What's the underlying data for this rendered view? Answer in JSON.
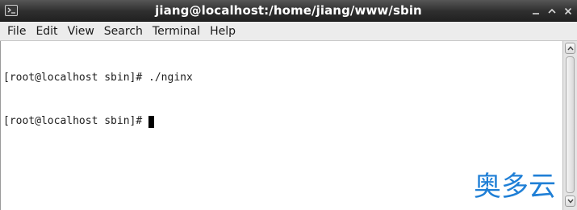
{
  "window": {
    "title": "jiang@localhost:/home/jiang/www/sbin",
    "icon": "terminal-icon",
    "controls": [
      "minimize-icon",
      "maximize-icon",
      "close-icon"
    ]
  },
  "menu": {
    "items": [
      "File",
      "Edit",
      "View",
      "Search",
      "Terminal",
      "Help"
    ]
  },
  "terminal": {
    "lines": [
      {
        "prompt": "[root@localhost sbin]#",
        "command": " ./nginx"
      },
      {
        "prompt": "[root@localhost sbin]#",
        "command": ""
      }
    ],
    "cursor": "block"
  },
  "watermark": {
    "text": "奥多云",
    "color": "#1f7fd6"
  }
}
